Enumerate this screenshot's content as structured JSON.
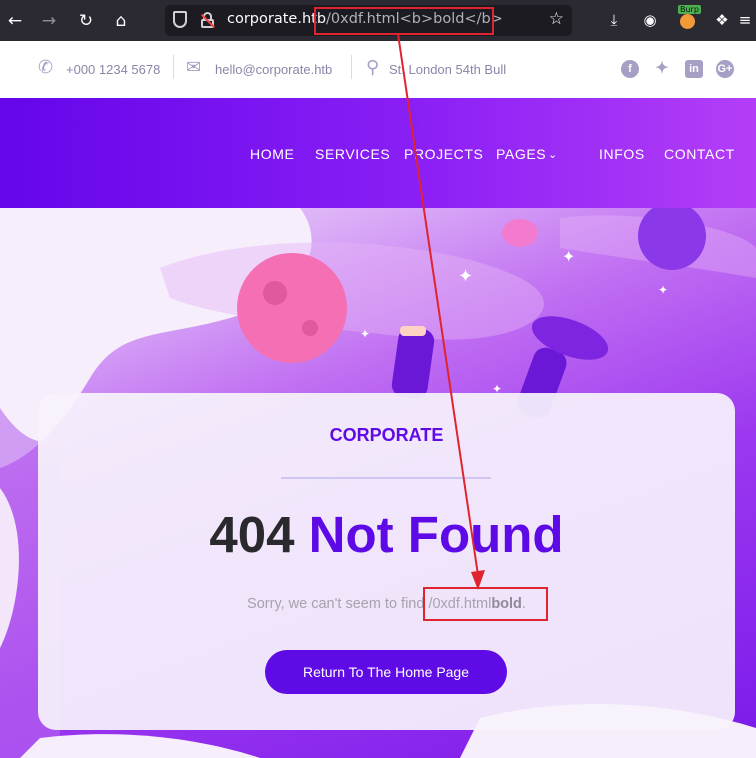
{
  "browser": {
    "url_host": "corporate.htb",
    "url_path": "/0xdf.html<b>bold</b>",
    "extension_label": "Burp"
  },
  "topbar": {
    "phone": "+000 1234 5678",
    "email": "hello@corporate.htb",
    "address": "St. London 54th Bull",
    "social": [
      "facebook-icon",
      "twitter-icon",
      "linkedin-icon",
      "google-plus-icon"
    ]
  },
  "nav": {
    "items": [
      "HOME",
      "SERVICES",
      "PROJECTS",
      "PAGES",
      "INFOS",
      "CONTACT"
    ]
  },
  "card": {
    "brand": "CORPORATE",
    "code": "404",
    "title": "Not Found",
    "sorry_prefix": "Sorry, we can't seem to find ",
    "path_plain": "/0xdf.html",
    "path_bold": "bold",
    "sorry_suffix": ".",
    "button": "Return To The Home Page"
  },
  "colors": {
    "accent": "#5f0be6",
    "annotation": "#e0242f",
    "nav_gradient_start": "#6405ea",
    "nav_gradient_end": "#b43ef7"
  }
}
